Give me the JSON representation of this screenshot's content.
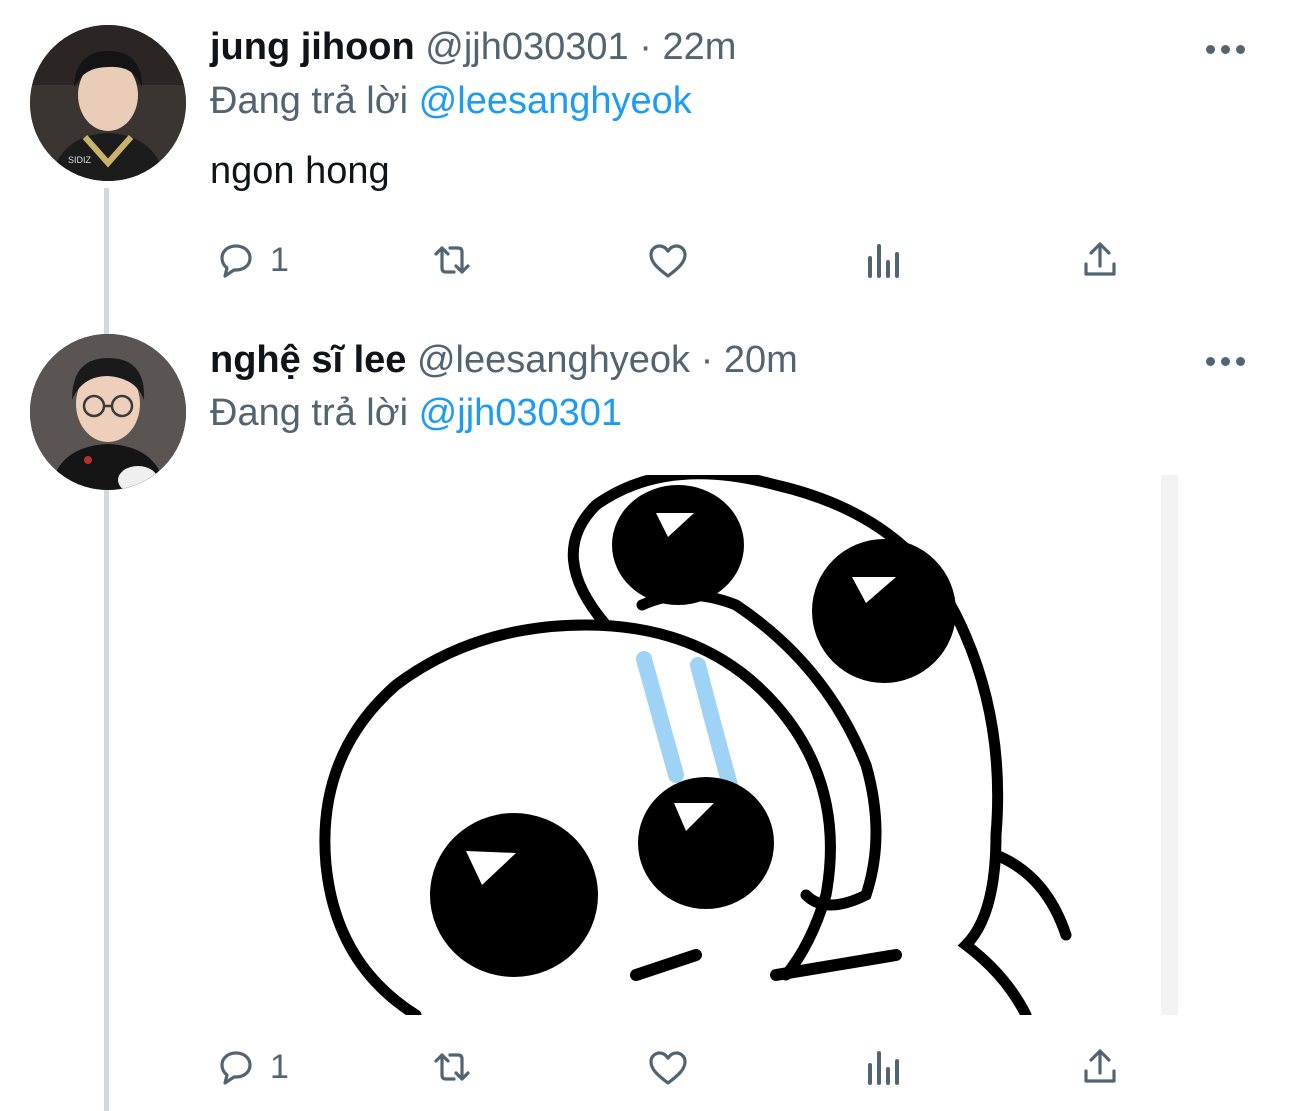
{
  "tweets": [
    {
      "name": "jung jihoon",
      "handle": "@jjh030301",
      "separator": "·",
      "time": "22m",
      "reply_prefix": "Đang trả lời",
      "reply_mention": "@leesanghyeok",
      "text": "ngon hong",
      "reply_count": "1",
      "avatar_icon": "avatar-photo"
    },
    {
      "name": "nghệ sĩ lee",
      "handle": "@leesanghyeok",
      "separator": "·",
      "time": "20m",
      "reply_prefix": "Đang trả lời",
      "reply_mention": "@jjh030301",
      "media_description": "cartoon-sticker",
      "reply_count": "1",
      "avatar_icon": "avatar-photo"
    }
  ],
  "colors": {
    "accent": "#1d9bf0",
    "secondary_text": "#536471",
    "primary_text": "#0f1419",
    "thread_line": "#cfd9de"
  },
  "icons": [
    "reply-icon",
    "retweet-icon",
    "like-icon",
    "views-icon",
    "share-icon",
    "more-icon"
  ]
}
